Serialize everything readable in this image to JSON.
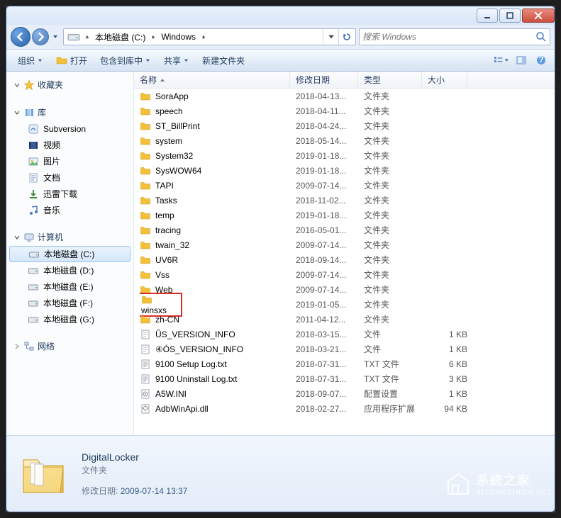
{
  "breadcrumb": {
    "segments": [
      "本地磁盘 (C:)",
      "Windows"
    ]
  },
  "search": {
    "placeholder": "搜索 Windows"
  },
  "toolbar": {
    "organize": "组织",
    "open": "打开",
    "include": "包含到库中",
    "share": "共享",
    "new_folder": "新建文件夹"
  },
  "columns": {
    "name": "名称",
    "date": "修改日期",
    "type": "类型",
    "size": "大小"
  },
  "nav": {
    "favorites": {
      "label": "收藏夹"
    },
    "libraries": {
      "label": "库",
      "items": [
        {
          "label": "Subversion",
          "icon": "subversion"
        },
        {
          "label": "视频",
          "icon": "video"
        },
        {
          "label": "图片",
          "icon": "pictures"
        },
        {
          "label": "文档",
          "icon": "documents"
        },
        {
          "label": "迅雷下载",
          "icon": "download"
        },
        {
          "label": "音乐",
          "icon": "music"
        }
      ]
    },
    "computer": {
      "label": "计算机",
      "items": [
        {
          "label": "本地磁盘 (C:)",
          "selected": true
        },
        {
          "label": "本地磁盘 (D:)"
        },
        {
          "label": "本地磁盘 (E:)"
        },
        {
          "label": "本地磁盘 (F:)"
        },
        {
          "label": "本地磁盘 (G:)"
        }
      ]
    },
    "network": {
      "label": "网络"
    }
  },
  "files": [
    {
      "name": "SoraApp",
      "date": "2018-04-13...",
      "type": "文件夹",
      "size": "",
      "icon": "folder"
    },
    {
      "name": "speech",
      "date": "2018-04-11...",
      "type": "文件夹",
      "size": "",
      "icon": "folder"
    },
    {
      "name": "ST_BillPrint",
      "date": "2018-04-24...",
      "type": "文件夹",
      "size": "",
      "icon": "folder"
    },
    {
      "name": "system",
      "date": "2018-05-14...",
      "type": "文件夹",
      "size": "",
      "icon": "folder"
    },
    {
      "name": "System32",
      "date": "2019-01-18...",
      "type": "文件夹",
      "size": "",
      "icon": "folder"
    },
    {
      "name": "SysWOW64",
      "date": "2019-01-18...",
      "type": "文件夹",
      "size": "",
      "icon": "folder"
    },
    {
      "name": "TAPI",
      "date": "2009-07-14...",
      "type": "文件夹",
      "size": "",
      "icon": "folder"
    },
    {
      "name": "Tasks",
      "date": "2018-11-02...",
      "type": "文件夹",
      "size": "",
      "icon": "folder"
    },
    {
      "name": "temp",
      "date": "2019-01-18...",
      "type": "文件夹",
      "size": "",
      "icon": "folder"
    },
    {
      "name": "tracing",
      "date": "2016-05-01...",
      "type": "文件夹",
      "size": "",
      "icon": "folder"
    },
    {
      "name": "twain_32",
      "date": "2009-07-14...",
      "type": "文件夹",
      "size": "",
      "icon": "folder"
    },
    {
      "name": "UV6R",
      "date": "2018-09-14...",
      "type": "文件夹",
      "size": "",
      "icon": "folder"
    },
    {
      "name": "Vss",
      "date": "2009-07-14...",
      "type": "文件夹",
      "size": "",
      "icon": "folder"
    },
    {
      "name": "Web",
      "date": "2009-07-14...",
      "type": "文件夹",
      "size": "",
      "icon": "folder"
    },
    {
      "name": "winsxs",
      "date": "2019-01-05...",
      "type": "文件夹",
      "size": "",
      "icon": "folder",
      "highlighted": true
    },
    {
      "name": "zh-CN",
      "date": "2011-04-12...",
      "type": "文件夹",
      "size": "",
      "icon": "folder"
    },
    {
      "name": "ÛS_VERSION_INFO",
      "date": "2018-03-15...",
      "type": "文件",
      "size": "1 KB",
      "icon": "file"
    },
    {
      "name": "④ÓS_VERSION_INFO",
      "date": "2018-03-21...",
      "type": "文件",
      "size": "1 KB",
      "icon": "file"
    },
    {
      "name": "9100 Setup Log.txt",
      "date": "2018-07-31...",
      "type": "TXT 文件",
      "size": "6 KB",
      "icon": "txt"
    },
    {
      "name": "9100 Uninstall Log.txt",
      "date": "2018-07-31...",
      "type": "TXT 文件",
      "size": "3 KB",
      "icon": "txt"
    },
    {
      "name": "A5W.INI",
      "date": "2018-09-07...",
      "type": "配置设置",
      "size": "1 KB",
      "icon": "ini"
    },
    {
      "name": "AdbWinApi.dll",
      "date": "2018-02-27...",
      "type": "应用程序扩展",
      "size": "94 KB",
      "icon": "dll"
    }
  ],
  "details": {
    "title": "DigitalLocker",
    "type": "文件夹",
    "date_label": "修改日期:",
    "date": "2009-07-14 13:37"
  },
  "watermark": {
    "line1": "系统之家",
    "line2": "XITONGZHIJIA.NET"
  }
}
